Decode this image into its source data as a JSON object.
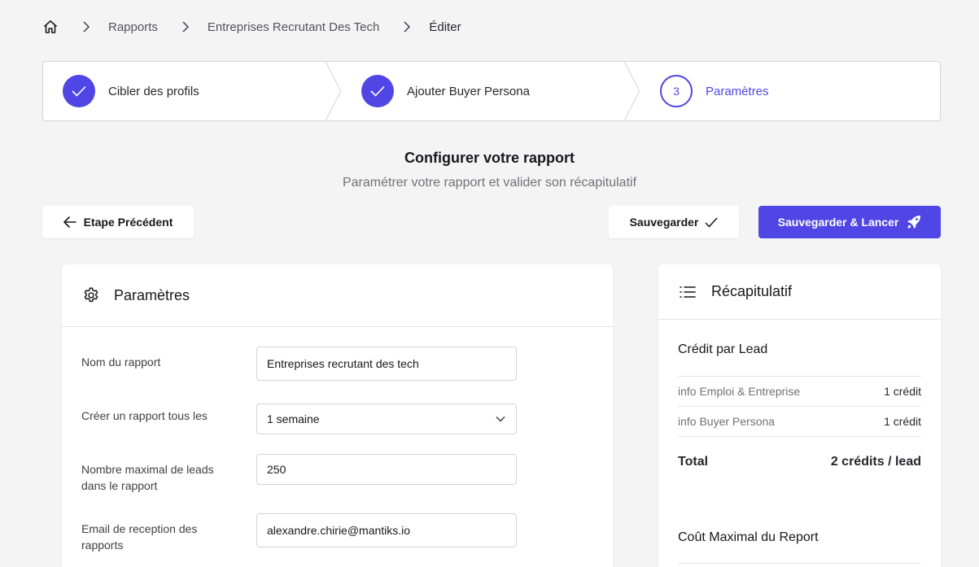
{
  "breadcrumb": {
    "home_icon": "home-icon",
    "items": [
      "Rapports",
      "Entreprises Recrutant Des Tech",
      "Éditer"
    ]
  },
  "stepper": {
    "steps": [
      {
        "label": "Cibler des profils",
        "state": "done"
      },
      {
        "label": "Ajouter Buyer Persona",
        "state": "done"
      },
      {
        "number": "3",
        "label": "Paramètres",
        "state": "active"
      }
    ]
  },
  "header": {
    "title": "Configurer votre rapport",
    "subtitle": "Paramétrer votre rapport et valider son récapitulatif"
  },
  "actions": {
    "previous_label": "Etape Précédent",
    "save_label": "Sauvegarder",
    "launch_label": "Sauvegarder & Lancer"
  },
  "params": {
    "title": "Paramètres",
    "icon": "gear-icon",
    "fields": [
      {
        "label": "Nom du rapport",
        "value": "Entreprises recrutant des tech"
      },
      {
        "label": "Créer un rapport tous les",
        "value": "1 semaine"
      },
      {
        "label": "Nombre maximal de leads dans le rapport",
        "value": "250"
      },
      {
        "label": "Email de reception des rapports",
        "value": "alexandre.chirie@mantiks.io"
      }
    ]
  },
  "recap": {
    "title": "Récapitulatif",
    "icon": "list-icon",
    "credit_title": "Crédit par Lead",
    "rows": [
      {
        "key": "info Emploi & Entreprise",
        "value": "1 crédit"
      },
      {
        "key": "info Buyer Persona",
        "value": "1 crédit"
      }
    ],
    "total_label": "Total",
    "total_value": "2 crédits / lead",
    "max_cost_title": "Coût Maximal du Report"
  },
  "colors": {
    "accent": "#4f46e5",
    "background": "#f4f4f5",
    "border": "#d4d4d8"
  }
}
